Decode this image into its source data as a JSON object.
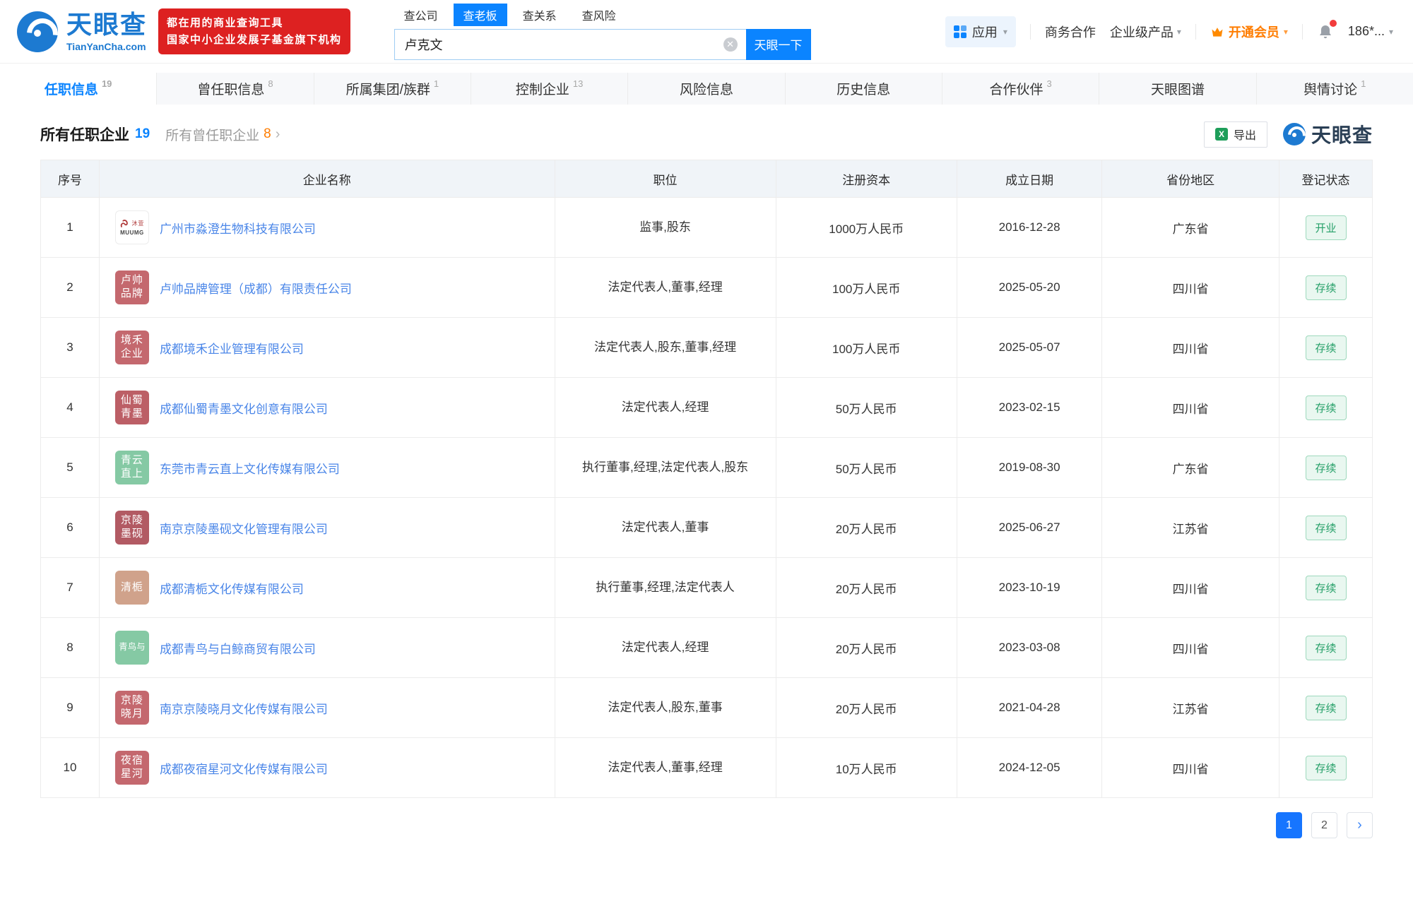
{
  "header": {
    "logo": {
      "title": "天眼查",
      "domain": "TianYanCha.com"
    },
    "banner": {
      "line1": "都在用的商业查询工具",
      "line2": "国家中小企业发展子基金旗下机构"
    },
    "search": {
      "tabs": [
        {
          "label": "查公司",
          "active": false
        },
        {
          "label": "查老板",
          "active": true
        },
        {
          "label": "查关系",
          "active": false
        },
        {
          "label": "查风险",
          "active": false
        }
      ],
      "value": "卢克文",
      "clear": "✕",
      "button": "天眼一下"
    },
    "nav": {
      "apps": "应用",
      "coop": "商务合作",
      "enterprise": "企业级产品",
      "vip": "开通会员",
      "user": "186*...",
      "caret": "▾"
    }
  },
  "page_tabs": [
    {
      "label": "任职信息",
      "count": "19",
      "active": true
    },
    {
      "label": "曾任职信息",
      "count": "8",
      "active": false
    },
    {
      "label": "所属集团/族群",
      "count": "1",
      "active": false
    },
    {
      "label": "控制企业",
      "count": "13",
      "active": false
    },
    {
      "label": "风险信息",
      "count": "",
      "active": false
    },
    {
      "label": "历史信息",
      "count": "",
      "active": false
    },
    {
      "label": "合作伙伴",
      "count": "3",
      "active": false
    },
    {
      "label": "天眼图谱",
      "count": "",
      "active": false
    },
    {
      "label": "舆情讨论",
      "count": "1",
      "active": false
    }
  ],
  "section": {
    "title": "所有任职企业",
    "count": "19",
    "alt_title": "所有曾任职企业",
    "alt_count": "8",
    "alt_arrow": "›",
    "export_label": "导出",
    "export_icon": "X",
    "watermark": "天眼查"
  },
  "table": {
    "headers": [
      "序号",
      "企业名称",
      "职位",
      "注册资本",
      "成立日期",
      "省份地区",
      "登记状态"
    ],
    "rows": [
      {
        "no": "1",
        "name": "广州市淼澄生物科技有限公司",
        "logo": {
          "style": "image",
          "lines": [
            "沐萱"
          ],
          "sub": "MUUMG",
          "bg": "#ffffff"
        },
        "position": "监事,股东",
        "capital": "1000万人民币",
        "date": "2016-12-28",
        "province": "广东省",
        "status": "开业"
      },
      {
        "no": "2",
        "name": "卢帅品牌管理（成都）有限责任公司",
        "logo": {
          "style": "text",
          "lines": [
            "卢帅",
            "品牌"
          ],
          "bg": "#c4686e"
        },
        "position": "法定代表人,董事,经理",
        "capital": "100万人民币",
        "date": "2025-05-20",
        "province": "四川省",
        "status": "存续"
      },
      {
        "no": "3",
        "name": "成都境禾企业管理有限公司",
        "logo": {
          "style": "text",
          "lines": [
            "境禾",
            "企业"
          ],
          "bg": "#c4686e"
        },
        "position": "法定代表人,股东,董事,经理",
        "capital": "100万人民币",
        "date": "2025-05-07",
        "province": "四川省",
        "status": "存续"
      },
      {
        "no": "4",
        "name": "成都仙蜀青墨文化创意有限公司",
        "logo": {
          "style": "text",
          "lines": [
            "仙蜀",
            "青墨"
          ],
          "bg": "#bc5f66"
        },
        "position": "法定代表人,经理",
        "capital": "50万人民币",
        "date": "2023-02-15",
        "province": "四川省",
        "status": "存续"
      },
      {
        "no": "5",
        "name": "东莞市青云直上文化传媒有限公司",
        "logo": {
          "style": "text",
          "lines": [
            "青云",
            "直上"
          ],
          "bg": "#85c9a4"
        },
        "position": "执行董事,经理,法定代表人,股东",
        "capital": "50万人民币",
        "date": "2019-08-30",
        "province": "广东省",
        "status": "存续"
      },
      {
        "no": "6",
        "name": "南京京陵墨砚文化管理有限公司",
        "logo": {
          "style": "text",
          "lines": [
            "京陵",
            "墨砚"
          ],
          "bg": "#b25a63"
        },
        "position": "法定代表人,董事",
        "capital": "20万人民币",
        "date": "2025-06-27",
        "province": "江苏省",
        "status": "存续"
      },
      {
        "no": "7",
        "name": "成都清栀文化传媒有限公司",
        "logo": {
          "style": "text",
          "lines": [
            "清栀"
          ],
          "bg": "#d0a28b"
        },
        "position": "执行董事,经理,法定代表人",
        "capital": "20万人民币",
        "date": "2023-10-19",
        "province": "四川省",
        "status": "存续"
      },
      {
        "no": "8",
        "name": "成都青鸟与白鲸商贸有限公司",
        "logo": {
          "style": "text",
          "lines": [
            "青鸟与"
          ],
          "bg": "#85c9a4"
        },
        "position": "法定代表人,经理",
        "capital": "20万人民币",
        "date": "2023-03-08",
        "province": "四川省",
        "status": "存续"
      },
      {
        "no": "9",
        "name": "南京京陵晓月文化传媒有限公司",
        "logo": {
          "style": "text",
          "lines": [
            "京陵",
            "晓月"
          ],
          "bg": "#c4686e"
        },
        "position": "法定代表人,股东,董事",
        "capital": "20万人民币",
        "date": "2021-04-28",
        "province": "江苏省",
        "status": "存续"
      },
      {
        "no": "10",
        "name": "成都夜宿星河文化传媒有限公司",
        "logo": {
          "style": "text",
          "lines": [
            "夜宿",
            "星河"
          ],
          "bg": "#c4686e"
        },
        "position": "法定代表人,董事,经理",
        "capital": "10万人民币",
        "date": "2024-12-05",
        "province": "四川省",
        "status": "存续"
      }
    ]
  },
  "pagination": {
    "pages": [
      {
        "label": "1",
        "active": true
      },
      {
        "label": "2",
        "active": false
      }
    ],
    "next": "›"
  },
  "colors": {
    "accent_blue": "#0b84ff",
    "link_blue": "#4a86e8",
    "status_green": "#26a069",
    "vip_orange": "#ff7d00",
    "banner_red": "#dd2121",
    "logo_blue": "#1d7ad1"
  }
}
